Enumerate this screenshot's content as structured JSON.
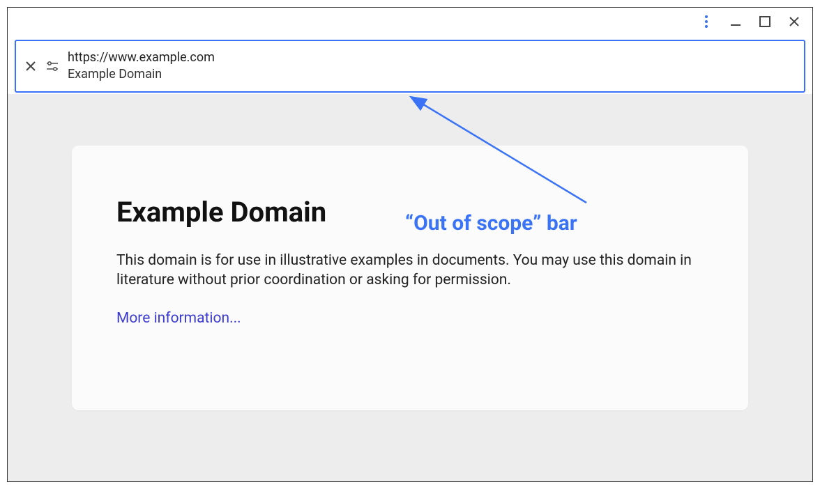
{
  "scope_bar": {
    "url": "https://www.example.com",
    "title": "Example Domain"
  },
  "page": {
    "heading": "Example Domain",
    "body": "This domain is for use in illustrative examples in documents. You may use this domain in literature without prior coordination or asking for permission.",
    "link_text": "More information..."
  },
  "annotation": {
    "label": "“Out of scope” bar"
  }
}
